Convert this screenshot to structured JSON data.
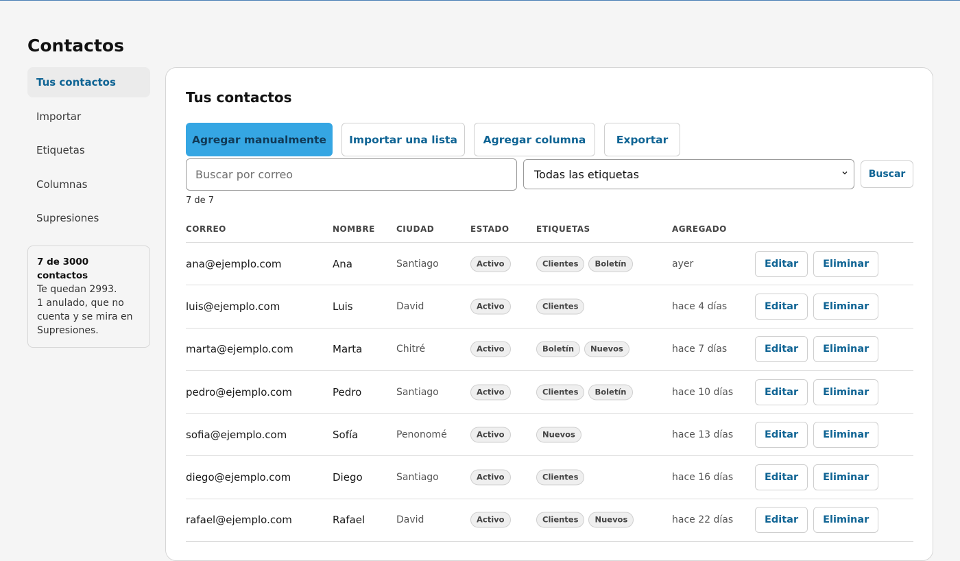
{
  "page": {
    "title": "Contactos"
  },
  "sidebar": {
    "items": [
      {
        "label": "Tus contactos",
        "active": true
      },
      {
        "label": "Importar",
        "active": false
      },
      {
        "label": "Etiquetas",
        "active": false
      },
      {
        "label": "Columnas",
        "active": false
      },
      {
        "label": "Supresiones",
        "active": false
      }
    ],
    "quota": {
      "title": "7 de 3000 contactos",
      "line1": "Te quedan 2993.",
      "line2": "1 anulado, que no cuenta y se mira en Supresiones."
    }
  },
  "main": {
    "title": "Tus contactos",
    "actions": {
      "add_manual": "Agregar manualmente",
      "import_list": "Importar una lista",
      "add_column": "Agregar columna",
      "export": "Exportar"
    },
    "search": {
      "placeholder": "Buscar por correo",
      "value": ""
    },
    "tag_filter": {
      "selected": "Todas las etiquetas"
    },
    "search_button": "Buscar",
    "count": "7 de 7"
  },
  "table": {
    "headers": {
      "email": "CORREO",
      "name": "NOMBRE",
      "city": "CIUDAD",
      "status": "ESTADO",
      "tags": "ETIQUETAS",
      "added": "AGREGADO"
    },
    "edit_label": "Editar",
    "delete_label": "Eliminar",
    "rows": [
      {
        "email": "ana@ejemplo.com",
        "name": "Ana",
        "city": "Santiago",
        "status": "Activo",
        "tags": [
          "Clientes",
          "Boletín"
        ],
        "added": "ayer"
      },
      {
        "email": "luis@ejemplo.com",
        "name": "Luis",
        "city": "David",
        "status": "Activo",
        "tags": [
          "Clientes"
        ],
        "added": "hace 4 días"
      },
      {
        "email": "marta@ejemplo.com",
        "name": "Marta",
        "city": "Chitré",
        "status": "Activo",
        "tags": [
          "Boletín",
          "Nuevos"
        ],
        "added": "hace 7 días"
      },
      {
        "email": "pedro@ejemplo.com",
        "name": "Pedro",
        "city": "Santiago",
        "status": "Activo",
        "tags": [
          "Clientes",
          "Boletín"
        ],
        "added": "hace 10 días"
      },
      {
        "email": "sofia@ejemplo.com",
        "name": "Sofía",
        "city": "Penonomé",
        "status": "Activo",
        "tags": [
          "Nuevos"
        ],
        "added": "hace 13 días"
      },
      {
        "email": "diego@ejemplo.com",
        "name": "Diego",
        "city": "Santiago",
        "status": "Activo",
        "tags": [
          "Clientes"
        ],
        "added": "hace 16 días"
      },
      {
        "email": "rafael@ejemplo.com",
        "name": "Rafael",
        "city": "David",
        "status": "Activo",
        "tags": [
          "Clientes",
          "Nuevos"
        ],
        "added": "hace 22 días"
      }
    ]
  },
  "colors": {
    "accent": "#0f6494",
    "primary_button": "#35a6e3",
    "background": "#f5f5f5"
  }
}
